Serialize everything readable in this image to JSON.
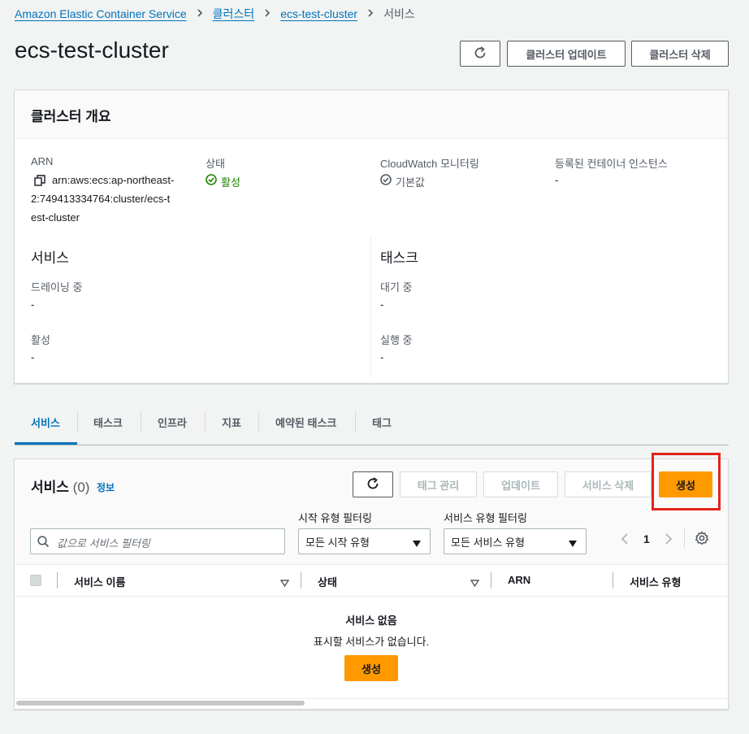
{
  "breadcrumb": {
    "items": [
      "Amazon Elastic Container Service",
      "클러스터",
      "ecs-test-cluster"
    ],
    "current": "서비스"
  },
  "page": {
    "title": "ecs-test-cluster",
    "update_button": "클러스터 업데이트",
    "delete_button": "클러스터 삭제"
  },
  "overview": {
    "title": "클러스터 개요",
    "arn_label": "ARN",
    "arn_lines": [
      "arn:aws:ecs:ap-northeast-",
      "2:749413334764:cluster/ecs-t",
      "est-cluster"
    ],
    "status_label": "상태",
    "status_value": "활성",
    "cloudwatch_label": "CloudWatch 모니터링",
    "cloudwatch_value": "기본값",
    "instances_label": "등록된 컨테이너 인스턴스",
    "instances_value": "-",
    "services_heading": "서비스",
    "draining_label": "드레이닝 중",
    "draining_value": "-",
    "active_label": "활성",
    "active_value": "-",
    "tasks_heading": "태스크",
    "pending_label": "대기 중",
    "pending_value": "-",
    "running_label": "실행 중",
    "running_value": "-"
  },
  "tabs": [
    "서비스",
    "태스크",
    "인프라",
    "지표",
    "예약된 태스크",
    "태그"
  ],
  "services": {
    "title": "서비스",
    "count": "(0)",
    "info_link": "정보",
    "manage_tags": "태그 관리",
    "update": "업데이트",
    "delete": "서비스 삭제",
    "create": "생성",
    "search_placeholder": "값으로 서비스 필터링",
    "launch_filter_label": "시작 유형 필터링",
    "launch_filter_value": "모든 시작 유형",
    "service_filter_label": "서비스 유형 필터링",
    "service_filter_value": "모든 서비스 유형",
    "page_number": "1",
    "columns": [
      "서비스 이름",
      "상태",
      "ARN",
      "서비스 유형"
    ],
    "empty_title": "서비스 없음",
    "empty_desc": "표시할 서비스가 없습니다.",
    "empty_create": "생성"
  },
  "colors": {
    "link": "#0073bb",
    "success": "#1d8102",
    "primary": "#ff9900",
    "highlight": "#e2231a"
  }
}
